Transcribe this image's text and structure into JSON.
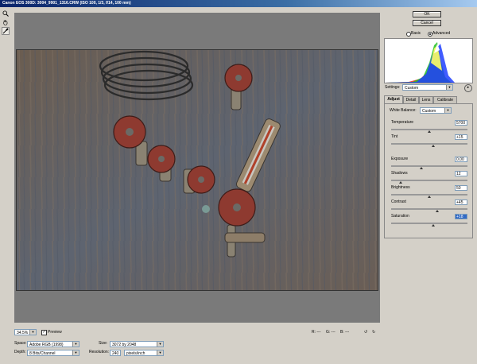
{
  "window": {
    "title": "Canon EOS 300D: 3004_9901_1316.CRW (ISO 100, 1/3, f/14, 100 mm)"
  },
  "tools": [
    {
      "name": "zoom-icon",
      "active": false
    },
    {
      "name": "hand-icon",
      "active": false
    },
    {
      "name": "eyedropper-icon",
      "active": true
    }
  ],
  "buttons": {
    "ok": "OK",
    "cancel": "Cancel"
  },
  "mode": {
    "basic": "Basic",
    "advanced": "Advanced",
    "selected": "advanced"
  },
  "settings": {
    "label": "Settings:",
    "value": "Custom"
  },
  "tabs": [
    {
      "label": "Adjust",
      "active": true
    },
    {
      "label": "Detail",
      "active": false
    },
    {
      "label": "Lens",
      "active": false
    },
    {
      "label": "Calibrate",
      "active": false
    }
  ],
  "white_balance": {
    "label": "White Balance:",
    "value": "Custom"
  },
  "sliders": [
    {
      "name": "Temperature",
      "value": "5700",
      "position": 0.5,
      "highlight": false
    },
    {
      "name": "Tint",
      "value": "+15",
      "position": 0.55,
      "highlight": false
    },
    {
      "name": "Exposure",
      "value": "0.00",
      "position": 0.4,
      "highlight": false
    },
    {
      "name": "Shadows",
      "value": "12",
      "position": 0.12,
      "highlight": false
    },
    {
      "name": "Brightness",
      "value": "50",
      "position": 0.5,
      "highlight": false
    },
    {
      "name": "Contrast",
      "value": "+45",
      "position": 0.6,
      "highlight": false
    },
    {
      "name": "Saturation",
      "value": "+18",
      "position": 0.55,
      "highlight": true
    }
  ],
  "zoom": {
    "value": "34.5%"
  },
  "preview": {
    "label": "Preview",
    "checked": true
  },
  "space": {
    "label": "Space:",
    "value": "Adobe RGB (1998)"
  },
  "depth": {
    "label": "Depth:",
    "value": "8 Bits/Channel"
  },
  "size": {
    "label": "Size:",
    "value": "3072 by 2048"
  },
  "resolution": {
    "label": "Resolution:",
    "value": "240",
    "unit": "pixels/inch"
  },
  "readout": {
    "r": "R:",
    "g": "G:",
    "b": "B:",
    "r_val": "---",
    "g_val": "---",
    "b_val": "---"
  },
  "colors": {
    "title_bar": "#0a246a",
    "panel_bg": "#d4d0c8",
    "preview_bg": "#7a7a7a"
  }
}
